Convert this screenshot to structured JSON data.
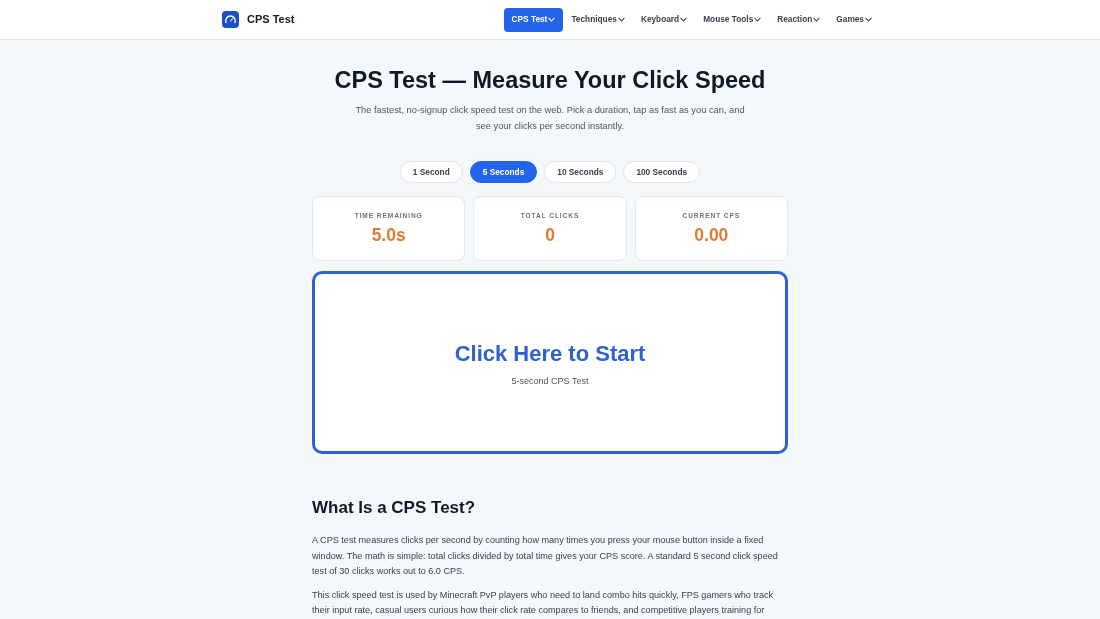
{
  "brand": {
    "name": "CPS Test"
  },
  "nav": [
    {
      "label": "CPS Test",
      "selected": true
    },
    {
      "label": "Techniques",
      "selected": false
    },
    {
      "label": "Keyboard",
      "selected": false
    },
    {
      "label": "Mouse Tools",
      "selected": false
    },
    {
      "label": "Reaction",
      "selected": false
    },
    {
      "label": "Games",
      "selected": false
    }
  ],
  "hero": {
    "title": "CPS Test — Measure Your Click Speed",
    "subtitle": "The fastest, no-signup click speed test on the web. Pick a duration, tap as fast as you can, and see your clicks per second instantly."
  },
  "durations": [
    {
      "label": "1 Second",
      "selected": false
    },
    {
      "label": "5 Seconds",
      "selected": true
    },
    {
      "label": "10 Seconds",
      "selected": false
    },
    {
      "label": "100 Seconds",
      "selected": false
    }
  ],
  "stats": [
    {
      "label": "TIME REMAINING",
      "value": "5.0s"
    },
    {
      "label": "TOTAL CLICKS",
      "value": "0"
    },
    {
      "label": "CURRENT CPS",
      "value": "0.00"
    }
  ],
  "click_area": {
    "title": "Click Here to Start",
    "caption": "5-second CPS Test"
  },
  "article": {
    "heading": "What Is a CPS Test?",
    "paragraphs": [
      "A CPS test measures clicks per second by counting how many times you press your mouse button inside a fixed window. The math is simple: total clicks divided by total time gives your CPS score. A standard 5 second click speed test of 30 clicks works out to 6.0 CPS.",
      "This click speed test is used by Minecraft PvP players who need to land combo hits quickly, FPS gamers who track their input rate, casual users curious how their click rate compares to friends, and competitive players training for"
    ]
  }
}
